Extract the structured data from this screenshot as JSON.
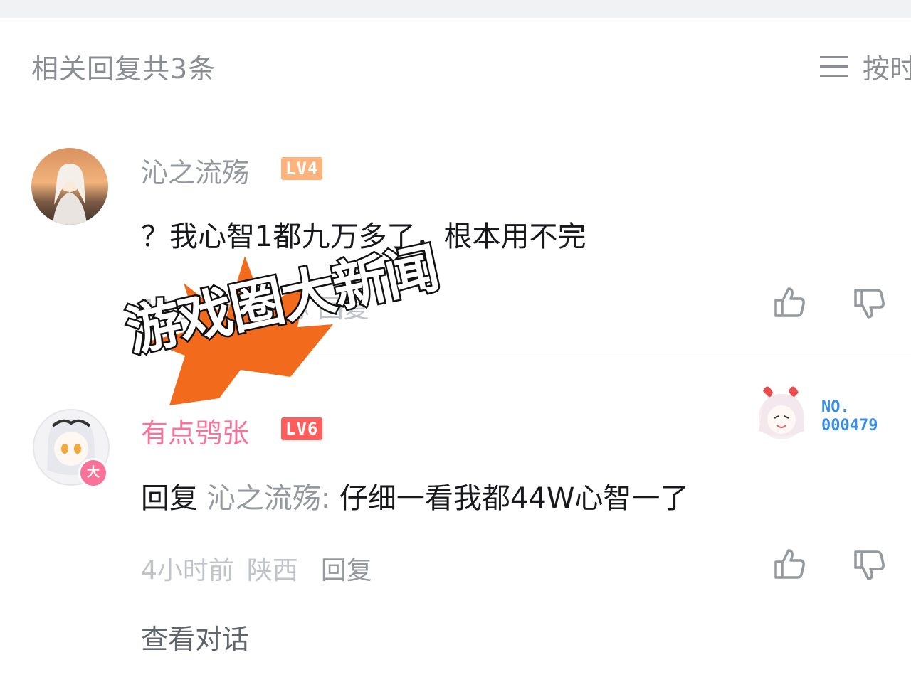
{
  "header": {
    "title": "相关回复共3条",
    "sort_label": "按时",
    "sort_icon": "menu-lines-icon"
  },
  "comments": [
    {
      "username": "沁之流殇",
      "level": "LV4",
      "content": "？我心智1都九万多了，根本用不完",
      "meta": "11小时前  江苏  回复",
      "like_icon": "thumb-up-icon",
      "dislike_icon": "thumb-down-icon"
    },
    {
      "username": "有点鸮张",
      "level": "LV6",
      "reply_prefix": "回复",
      "reply_target": "沁之流殇:",
      "content": "仔细一看我都44W心智一了",
      "time": "4小时前",
      "location": "陕西",
      "reply_label": "回复",
      "avatar_badge": "大",
      "fan_badge": {
        "line1": "NO.",
        "line2": "000479"
      },
      "like_icon": "thumb-up-icon",
      "dislike_icon": "thumb-down-icon"
    }
  ],
  "view_conversation": "查看对话",
  "overlay": {
    "text": "游戏圈大新闻",
    "burst_color": "#f26a1b"
  },
  "colors": {
    "username_default": "#9499a0",
    "username_vip": "#fb7299",
    "lv4": "#ffb37c",
    "lv6": "#ff5c5c",
    "text": "#18191c",
    "meta": "#c0c4ca"
  }
}
